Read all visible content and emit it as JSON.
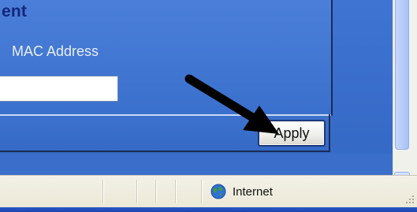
{
  "panel": {
    "title": "ent",
    "mac_label": "MAC Address",
    "mac_value": "",
    "apply_label": "Apply"
  },
  "statusbar": {
    "zone_label": "Internet",
    "zone_icon": "globe-icon"
  },
  "scrollbar": {
    "down_icon": "chevron-down-icon"
  },
  "colors": {
    "page_blue": "#3f74cf",
    "title_navy": "#14277a",
    "statusbar_bg": "#ece9d8",
    "taskbar_blue": "#1e46b0"
  }
}
